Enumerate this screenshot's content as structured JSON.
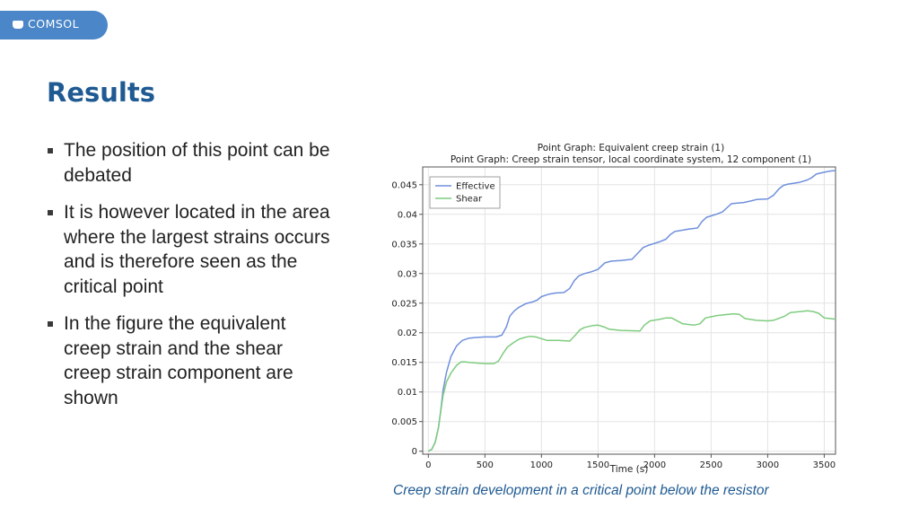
{
  "header": {
    "logo_text": "COMSOL"
  },
  "slide": {
    "title": "Results",
    "bullets": [
      "The position of this point can be debated",
      "It is however located in the area where the largest strains occurs and is therefore seen as the critical point",
      "In the figure the equivalent creep strain and the shear creep strain component are shown"
    ],
    "caption": "Creep strain development in a critical point below the resistor"
  },
  "chart_data": {
    "type": "line",
    "title": "Point Graph: Equivalent creep strain (1)",
    "subtitle": "Point Graph: Creep strain tensor, local coordinate system, 12 component (1)",
    "xlabel": "Time (s)",
    "ylabel": "",
    "xlim": [
      -50,
      3600
    ],
    "ylim": [
      -0.0005,
      0.048
    ],
    "xticks": [
      0,
      500,
      1000,
      1500,
      2000,
      2500,
      3000,
      3500
    ],
    "xtick_labels": [
      "0",
      "500",
      "1000",
      "1500",
      "2000",
      "2500",
      "3000",
      "3500"
    ],
    "yticks": [
      0,
      0.005,
      0.01,
      0.015,
      0.02,
      0.025,
      0.03,
      0.035,
      0.04,
      0.045
    ],
    "ytick_labels": [
      "0",
      "0.005",
      "0.01",
      "0.015",
      "0.02",
      "0.025",
      "0.03",
      "0.035",
      "0.04",
      "0.045"
    ],
    "grid": true,
    "legend": "top-left",
    "series": [
      {
        "name": "Effective",
        "color": "#7090dc",
        "x": [
          0,
          30,
          60,
          90,
          110,
          130,
          160,
          200,
          250,
          300,
          360,
          420,
          500,
          600,
          650,
          690,
          720,
          760,
          800,
          860,
          920,
          960,
          1000,
          1060,
          1120,
          1200,
          1250,
          1290,
          1330,
          1380,
          1440,
          1500,
          1560,
          1620,
          1700,
          1800,
          1860,
          1900,
          1950,
          2050,
          2100,
          2140,
          2180,
          2300,
          2380,
          2420,
          2460,
          2560,
          2600,
          2640,
          2680,
          2790,
          2860,
          2900,
          3000,
          3050,
          3100,
          3140,
          3180,
          3280,
          3350,
          3390,
          3430,
          3500,
          3550,
          3600
        ],
        "values": [
          0,
          0.0003,
          0.0015,
          0.004,
          0.007,
          0.0103,
          0.0133,
          0.016,
          0.0178,
          0.0187,
          0.0191,
          0.0192,
          0.0193,
          0.0193,
          0.0196,
          0.021,
          0.0228,
          0.0237,
          0.0243,
          0.0249,
          0.0252,
          0.0255,
          0.0261,
          0.0265,
          0.0267,
          0.0268,
          0.0275,
          0.0288,
          0.0296,
          0.03,
          0.0303,
          0.0307,
          0.0318,
          0.0321,
          0.0322,
          0.0324,
          0.0336,
          0.0344,
          0.0348,
          0.0354,
          0.0358,
          0.0366,
          0.0371,
          0.0375,
          0.0377,
          0.0388,
          0.0395,
          0.0401,
          0.0404,
          0.0411,
          0.0418,
          0.042,
          0.0423,
          0.0425,
          0.0426,
          0.0432,
          0.0443,
          0.0449,
          0.0451,
          0.0454,
          0.0458,
          0.0462,
          0.0468,
          0.0471,
          0.0473,
          0.0474
        ]
      },
      {
        "name": "Shear",
        "color": "#7fcc7f",
        "x": [
          0,
          30,
          60,
          90,
          110,
          130,
          160,
          200,
          250,
          290,
          320,
          360,
          420,
          500,
          580,
          620,
          660,
          700,
          750,
          800,
          850,
          900,
          950,
          1000,
          1050,
          1150,
          1250,
          1300,
          1340,
          1380,
          1450,
          1500,
          1550,
          1600,
          1700,
          1870,
          1910,
          1960,
          2050,
          2100,
          2150,
          2250,
          2350,
          2400,
          2450,
          2550,
          2650,
          2700,
          2750,
          2800,
          2900,
          3000,
          3050,
          3150,
          3200,
          3250,
          3300,
          3350,
          3400,
          3450,
          3500,
          3550,
          3600
        ],
        "values": [
          0,
          0.0003,
          0.0015,
          0.004,
          0.0068,
          0.0094,
          0.0117,
          0.0132,
          0.0145,
          0.0151,
          0.0151,
          0.015,
          0.0149,
          0.0148,
          0.0148,
          0.0152,
          0.0165,
          0.0176,
          0.0183,
          0.0189,
          0.0192,
          0.0194,
          0.0193,
          0.019,
          0.0187,
          0.0187,
          0.0186,
          0.0196,
          0.0205,
          0.0209,
          0.0212,
          0.0213,
          0.021,
          0.0206,
          0.0204,
          0.0203,
          0.0213,
          0.022,
          0.0223,
          0.0225,
          0.0225,
          0.0215,
          0.0213,
          0.0215,
          0.0225,
          0.0229,
          0.0231,
          0.0232,
          0.0231,
          0.0224,
          0.0221,
          0.022,
          0.0221,
          0.0228,
          0.0234,
          0.0235,
          0.0236,
          0.0237,
          0.0236,
          0.0233,
          0.0225,
          0.0224,
          0.0223
        ]
      }
    ]
  },
  "colors": {
    "title": "#1f5a92",
    "caption": "#1f5a92",
    "logo_tab": "#4a86c8",
    "effective": "#7090dc",
    "shear": "#7fcc7f"
  }
}
